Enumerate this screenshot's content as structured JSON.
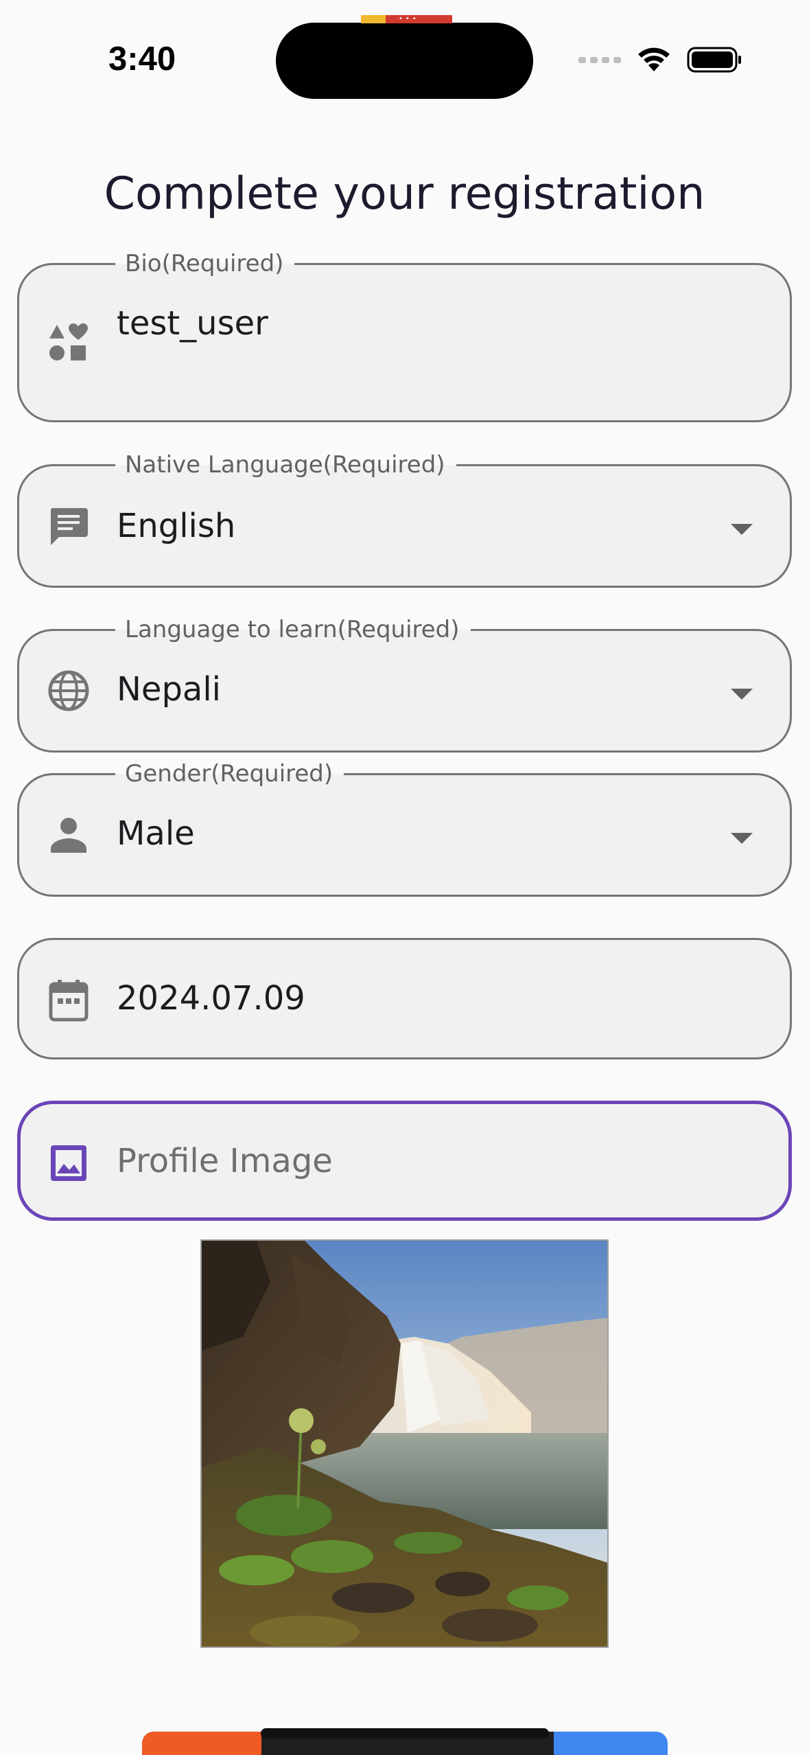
{
  "status_bar": {
    "time": "3:40"
  },
  "page": {
    "title": "Complete your registration"
  },
  "fields": {
    "bio": {
      "label": "Bio(Required)",
      "value": "test_user",
      "icon": "interests-icon"
    },
    "native_language": {
      "label": "Native Language(Required)",
      "value": "English",
      "icon": "message-icon"
    },
    "language_to_learn": {
      "label": "Language to learn(Required)",
      "value": "Nepali",
      "icon": "globe-icon"
    },
    "gender": {
      "label": "Gender(Required)",
      "value": "Male",
      "icon": "person-icon"
    },
    "birth_date": {
      "value": "2024.07.09",
      "icon": "calendar-icon"
    },
    "profile_image": {
      "placeholder": "Profile Image",
      "icon": "image-icon"
    }
  },
  "colors": {
    "focus_border": "#6a45b8",
    "field_border": "#757575",
    "field_fill": "#f1f1f1",
    "background": "#fafafa",
    "icon": "#757575"
  }
}
